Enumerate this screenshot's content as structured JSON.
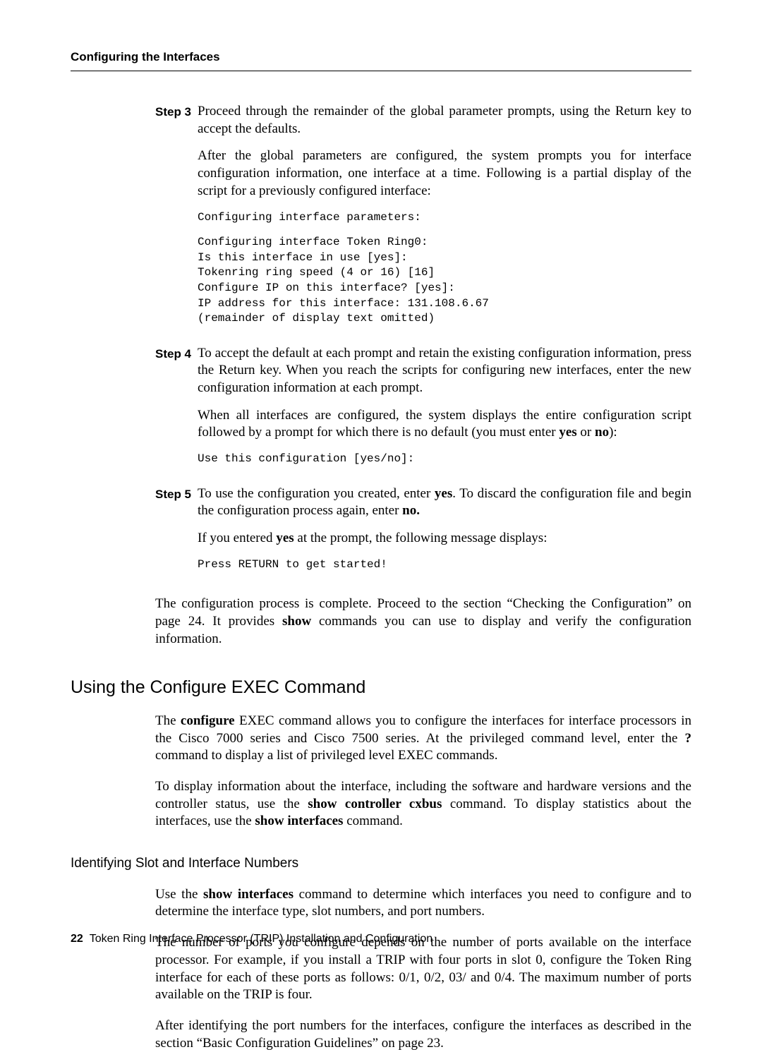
{
  "running_head": "Configuring the Interfaces",
  "steps": {
    "s3_label": "Step 3",
    "s3_p1": "Proceed through the remainder of the global parameter prompts, using the Return key to accept the defaults.",
    "s3_p2": "After the global parameters are configured, the system prompts you for interface configuration information, one interface at a time. Following is a partial display of the script for a previously configured interface:",
    "s3_code1": "Configuring interface parameters:",
    "s3_code2": "Configuring interface Token Ring0:\nIs this interface in use [yes]:\nTokenring ring speed (4 or 16) [16]\nConfigure IP on this interface? [yes]:\nIP address for this interface: 131.108.6.67\n(remainder of display text omitted)",
    "s4_label": "Step 4",
    "s4_p1": "To accept the default at each prompt and retain the existing configuration information, press the Return key. When you reach the scripts for configuring new interfaces, enter the new configuration information at each prompt.",
    "s4_p2a": "When all interfaces are configured, the system displays the entire configuration script followed by a prompt for which there is no default (you must enter ",
    "s4_p2_yes": "yes",
    "s4_p2_or": " or ",
    "s4_p2_no": "no",
    "s4_p2b": "):",
    "s4_code": "Use this configuration [yes/no]:",
    "s5_label": "Step 5",
    "s5_p1a": "To use the configuration you created, enter ",
    "s5_p1_yes": "yes",
    "s5_p1b": ". To discard the configuration file and begin the configuration process again, enter ",
    "s5_p1_no": "no.",
    "s5_p2a": "If you entered ",
    "s5_p2_yes": "yes",
    "s5_p2b": " at the prompt, the following message displays:",
    "s5_code": "Press RETURN to get started!"
  },
  "after_steps_a": "The configuration process is complete. Proceed to the section “Checking the Configuration” on page 24. It provides ",
  "after_steps_show": "show",
  "after_steps_b": " commands you can use to display and verify the configuration information.",
  "h2": "Using the Configure EXEC Command",
  "sec_p1a": "The ",
  "sec_p1_configure": "configure",
  "sec_p1b": " EXEC command allows you to configure the interfaces for interface processors in the Cisco 7000 series and Cisco 7500 series. At the privileged command level, enter the ",
  "sec_p1_q": "?",
  "sec_p1c": " command to display a list of privileged level EXEC commands.",
  "sec_p2a": "To display information about the interface, including the software and hardware versions and the controller status, use the ",
  "sec_p2_scc": "show controller cxbus",
  "sec_p2b": " command. To display statistics about the interfaces, use the ",
  "sec_p2_si": "show interfaces",
  "sec_p2c": " command.",
  "h3": "Identifying Slot and Interface Numbers",
  "sub_p1a": "Use the ",
  "sub_p1_si": "show interfaces",
  "sub_p1b": " command to determine which interfaces you need to configure and to determine the interface type, slot numbers, and port numbers.",
  "sub_p2": "The number of ports you configure depends on the number of ports available on the interface processor. For example, if you install a TRIP with four ports in slot 0, configure the Token Ring interface for each of these ports as follows: 0/1, 0/2, 03/ and 0/4. The maximum number of ports available on the TRIP is four.",
  "sub_p3": "After identifying the port numbers for the interfaces, configure the interfaces as described in the section “Basic Configuration Guidelines” on page 23.",
  "footer_page": "22",
  "footer_title": "Token Ring Interface Processor (TRIP) Installation and Configuration"
}
